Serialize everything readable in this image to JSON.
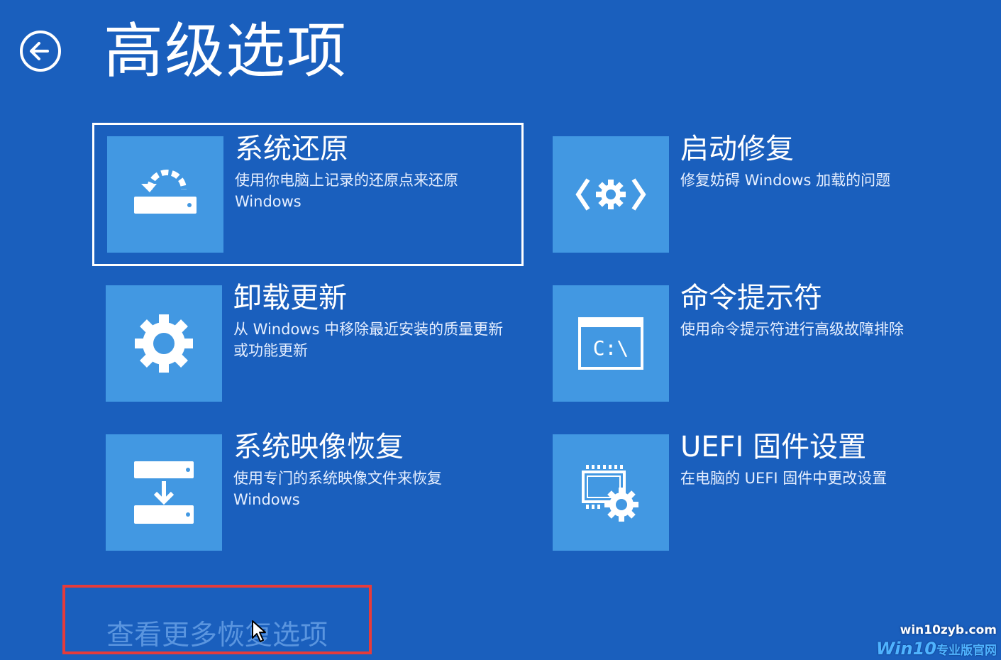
{
  "page": {
    "title": "高级选项"
  },
  "tiles": [
    {
      "title": "系统还原",
      "desc": "使用你电脑上记录的还原点来还原 Windows",
      "icon": "system-restore-icon"
    },
    {
      "title": "启动修复",
      "desc": "修复妨碍 Windows 加载的问题",
      "icon": "startup-repair-icon"
    },
    {
      "title": "卸载更新",
      "desc": "从 Windows 中移除最近安装的质量更新或功能更新",
      "icon": "gear-icon"
    },
    {
      "title": "命令提示符",
      "desc": "使用命令提示符进行高级故障排除",
      "icon": "command-prompt-icon",
      "prompt": "C:\\"
    },
    {
      "title": "系统映像恢复",
      "desc": "使用专门的系统映像文件来恢复 Windows",
      "icon": "system-image-icon"
    },
    {
      "title": "UEFI 固件设置",
      "desc": "在电脑的 UEFI 固件中更改设置",
      "icon": "uefi-chip-icon"
    }
  ],
  "more_link": "查看更多恢复选项",
  "watermark": {
    "url": "win10zyb.com",
    "brand": "Win10",
    "brand_suffix": "专业版官网"
  },
  "colors": {
    "background": "#1a5fbd",
    "tile_icon": "#4298e2",
    "highlight": "#e53b3b"
  }
}
